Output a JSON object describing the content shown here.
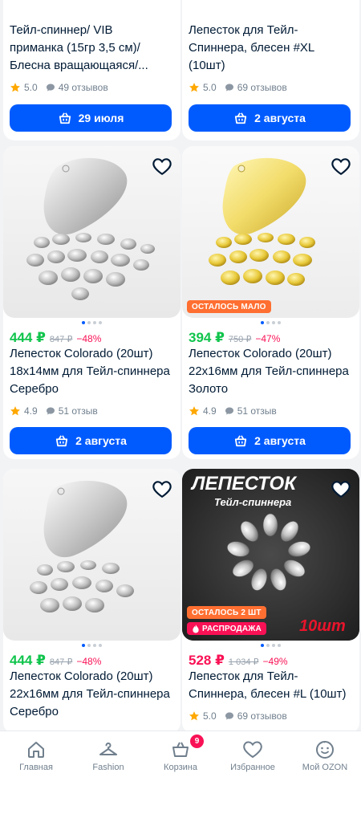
{
  "colors": {
    "accent": "#005bff",
    "price_green": "#10c44c",
    "sale_red": "#f91155",
    "badge_orange": "#ff6f31"
  },
  "top_cards": [
    {
      "title_lines": [
        "Тейл-спиннер/ VIB",
        "приманка (15гр 3,5 см)/",
        "Блесна вращающаяся/..."
      ],
      "rating": "5.0",
      "reviews": "49 отзывов",
      "delivery": "29 июля"
    },
    {
      "title_lines": [
        "Лепесток для Тейл-",
        "Спиннера, блесен #XL",
        "(10шт)"
      ],
      "rating": "5.0",
      "reviews": "69 отзывов",
      "delivery": "2 августа"
    }
  ],
  "products": [
    {
      "price": "444 ₽",
      "old_price": "847 ₽",
      "discount": "−48%",
      "title_lines": [
        "Лепесток Colorado (20шт)",
        "18x14мм для Тейл-спиннера",
        "Серебро"
      ],
      "rating": "4.9",
      "reviews": "51 отзыв",
      "delivery": "2 августа"
    },
    {
      "price": "394 ₽",
      "old_price": "750 ₽",
      "discount": "−47%",
      "badge": "ОСТАЛОСЬ МАЛО",
      "title_lines": [
        "Лепесток Colorado (20шт)",
        "22x16мм для Тейл-спиннера",
        "Золото"
      ],
      "rating": "4.9",
      "reviews": "51 отзыв",
      "delivery": "2 августа"
    },
    {
      "price": "444 ₽",
      "old_price": "847 ₽",
      "discount": "−48%",
      "title_lines": [
        "Лепесток Colorado (20шт)",
        "22x16мм для Тейл-спиннера",
        "Серебро"
      ]
    },
    {
      "price": "528 ₽",
      "old_price": "1 034 ₽",
      "discount": "−49%",
      "badge_stock": "ОСТАЛОСЬ 2 ШТ",
      "badge_sale": "РАСПРОДАЖА",
      "image_text": [
        "ЛЕПЕСТОК",
        "Тейл-спиннера",
        "10шт"
      ],
      "title_lines": [
        "Лепесток для Тейл-",
        "Спиннера, блесен #L (10шт)"
      ],
      "rating": "5.0",
      "reviews": "69 отзывов"
    }
  ],
  "tabbar": {
    "items": [
      {
        "label": "Главная",
        "icon": "home-icon"
      },
      {
        "label": "Fashion",
        "icon": "hanger-icon"
      },
      {
        "label": "Корзина",
        "icon": "cart-icon",
        "count": "9"
      },
      {
        "label": "Избранное",
        "icon": "heart-icon"
      },
      {
        "label": "Мой OZON",
        "icon": "profile-icon"
      }
    ]
  }
}
